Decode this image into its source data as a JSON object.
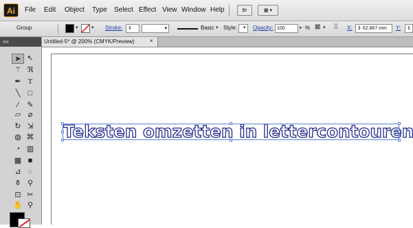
{
  "app": {
    "logo": "Ai"
  },
  "menu": [
    "File",
    "Edit",
    "Object",
    "Type",
    "Select",
    "Effect",
    "View",
    "Window",
    "Help"
  ],
  "menu_icons": {
    "bridge": "Br",
    "arrange": "▦ ▾"
  },
  "control": {
    "group": "Group",
    "stroke_label": "Stroke:",
    "stroke_profile": "Basic",
    "style_label": "Style:",
    "opacity_label": "Opacity:",
    "opacity_value": "100",
    "opacity_unit": "%",
    "x_label": "X:",
    "x_value": "62.867 mm",
    "y_label": "Y:"
  },
  "document": {
    "tab_title": "Untitled-5* @ 200% (CMYK/Preview)",
    "close": "×"
  },
  "tools_panel": {
    "collapse": "««"
  },
  "canvas": {
    "text": "Teksten omzetten in lettercontouren"
  },
  "icons": {
    "selection": "selection-tool-icon",
    "direct_selection": "direct-selection-tool-icon",
    "magic_wand": "magic-wand-icon",
    "lasso": "lasso-icon",
    "pen": "pen-tool-icon",
    "type": "type-tool-icon"
  },
  "colors": {
    "fill": "#000000",
    "stroke_none": "#e02020",
    "text_outline": "#1f2a8a",
    "selection": "#5b7cd6"
  }
}
